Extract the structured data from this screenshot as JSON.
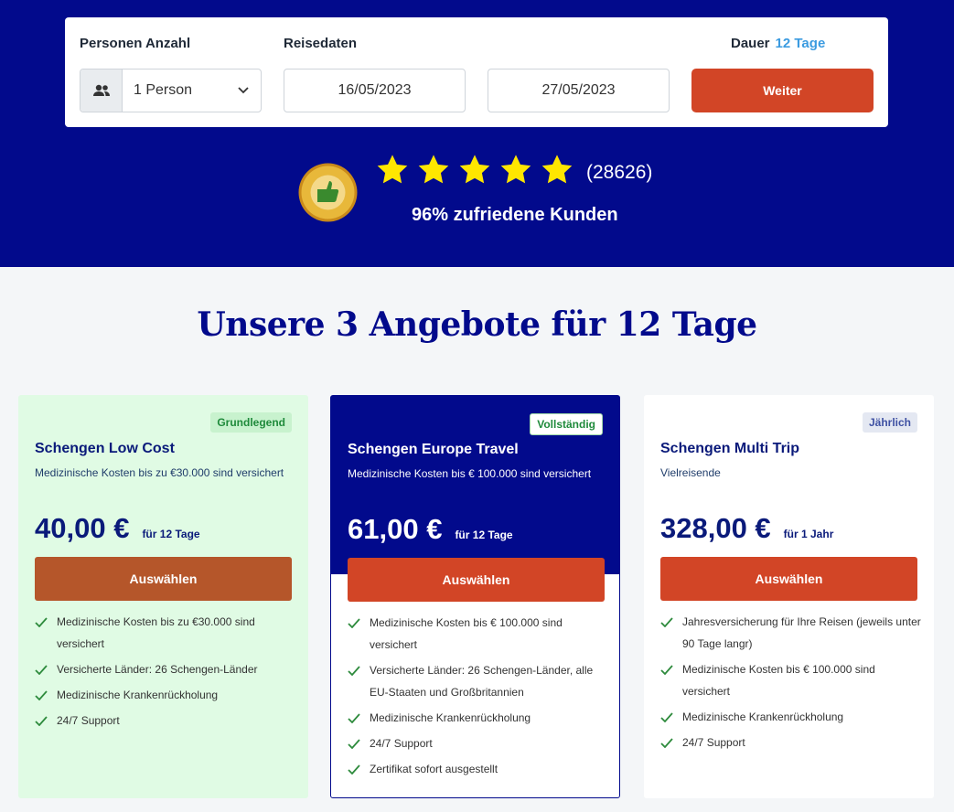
{
  "search": {
    "persons_label": "Personen Anzahl",
    "persons_value": "1 Person",
    "dates_label": "Reisedaten",
    "start_date": "16/05/2023",
    "end_date": "27/05/2023",
    "duration_label": "Dauer",
    "duration_value": "12 Tage",
    "next_button": "Weiter"
  },
  "rating": {
    "stars": 5,
    "count": "(28626)",
    "satisfied": "96% zufriedene Kunden",
    "badge_icon": "ekomi-award-badge"
  },
  "section_title": "Unsere 3 Angebote für 12 Tage",
  "cards": [
    {
      "tag": "Grundlegend",
      "name": "Schengen Low Cost",
      "desc": "Medizinische Kosten bis zu €30.000 sind versichert",
      "price": "40,00 €",
      "per": "für 12 Tage",
      "button": "Auswählen",
      "features": [
        "Medizinische Kosten bis zu €30.000 sind versichert",
        "Versicherte Länder: 26 Schengen-Länder",
        "Medizinische Krankenrückholung",
        "24/7 Support"
      ]
    },
    {
      "tag": "Vollständig",
      "name": "Schengen Europe Travel",
      "desc": "Medizinische Kosten bis € 100.000 sind versichert",
      "price": "61,00 €",
      "per": "für 12 Tage",
      "button": "Auswählen",
      "features": [
        "Medizinische Kosten bis € 100.000 sind versichert",
        "Versicherte Länder: 26 Schengen-Länder, alle EU-Staaten und Großbritannien",
        "Medizinische Krankenrückholung",
        "24/7 Support",
        "Zertifikat sofort ausgestellt"
      ]
    },
    {
      "tag": "Jährlich",
      "name": "Schengen Multi Trip",
      "desc": "Vielreisende",
      "price": "328,00 €",
      "per": "für 1 Jahr",
      "button": "Auswählen",
      "features": [
        "Jahresversicherung für Ihre Reisen (jeweils unter 90 Tage langr)",
        "Medizinische Kosten bis € 100.000 sind versichert",
        "Medizinische Krankenrückholung",
        "24/7 Support"
      ]
    }
  ],
  "colors": {
    "brand_blue": "#020a8c",
    "accent_orange": "#d24526",
    "card1_bg": "#e0fbe4",
    "duration_blue": "#3b9be0",
    "check_green": "#2e8b3d",
    "star_yellow": "#ffe600"
  }
}
